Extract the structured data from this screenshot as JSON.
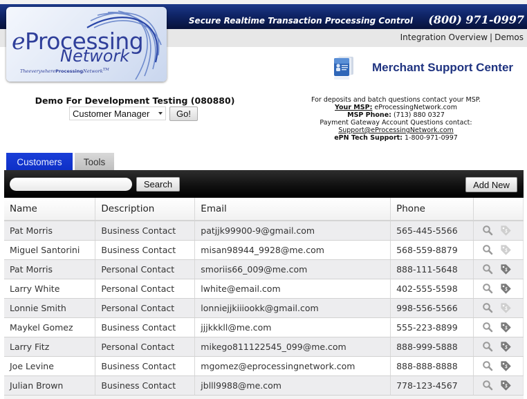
{
  "header": {
    "tagline": "Secure Realtime Transaction Processing Control",
    "phone": "(800) 971-0997",
    "links": [
      {
        "label": "Integration Overview"
      },
      {
        "label": "Demos"
      }
    ],
    "link_separator": "|"
  },
  "logo": {
    "line1_prefix": "e",
    "line1_rest": "Processing",
    "line2": "Network",
    "slogan_pre": "The",
    "slogan_everywhere": "everywhere",
    "slogan_processing": "Processing",
    "slogan_network": "Network",
    "slogan_tm": "TM"
  },
  "support_center": {
    "title": "Merchant Support Center",
    "icon": "id-card-icon"
  },
  "account": {
    "title": "Demo For Development Testing (080880)",
    "selected_module": "Customer Manager",
    "go_label": "Go!"
  },
  "contact": {
    "line1": "For deposits and batch questions contact your MSP.",
    "msp_label": "Your MSP:",
    "msp_value": "eProcessingNetwork.com",
    "msp_phone_label": "MSP Phone:",
    "msp_phone_value": "(713) 880 0327",
    "gateway_line": "Payment Gateway Account Questions contact:",
    "support_email": "Support@eProcessingNetwork.com",
    "tech_label": "ePN Tech Support:",
    "tech_value": "1-800-971-0997"
  },
  "tabs": [
    {
      "label": "Customers",
      "active": true
    },
    {
      "label": "Tools",
      "active": false
    }
  ],
  "toolbar": {
    "search_value": "",
    "search_label": "Search",
    "add_label": "Add New"
  },
  "table": {
    "columns": [
      "Name",
      "Description",
      "Email",
      "Phone",
      ""
    ],
    "rows": [
      {
        "name": "Pat Morris",
        "description": "Business Contact",
        "email": "patjjk99900-9@gmail.com",
        "phone": "565-445-5566",
        "tag_active": false
      },
      {
        "name": "Miguel Santorini",
        "description": "Business Contact",
        "email": "misan98944_9928@me.com",
        "phone": "568-559-8879",
        "tag_active": false
      },
      {
        "name": "Pat Morris",
        "description": "Personal Contact",
        "email": "smoriis66_009@me.com",
        "phone": "888-111-5648",
        "tag_active": true
      },
      {
        "name": "Larry White",
        "description": "Personal Contact",
        "email": "lwhite@email.com",
        "phone": "402-555-5598",
        "tag_active": true
      },
      {
        "name": "Lonnie Smith",
        "description": "Personal Contact",
        "email": "lonniejjkiiiookk@gmail.com",
        "phone": "998-556-5566",
        "tag_active": false
      },
      {
        "name": "Maykel Gomez",
        "description": "Business Contact",
        "email": "jjjkkkll@me.com",
        "phone": "555-223-8899",
        "tag_active": true
      },
      {
        "name": "Larry Fitz",
        "description": "Personal Contact",
        "email": "mikego811122545_099@me.com",
        "phone": "888-999-5888",
        "tag_active": true
      },
      {
        "name": "Joe Levine",
        "description": "Business Contact",
        "email": "mgomez@eprocessingnetwork.com",
        "phone": "888-888-8888",
        "tag_active": true
      },
      {
        "name": "Julian Brown",
        "description": "Business Contact",
        "email": "jblll9988@me.com",
        "phone": "778-123-4567",
        "tag_active": true
      }
    ]
  },
  "colors": {
    "banner": "#0f2466",
    "tab_active": "#1437d0",
    "title_blue": "#1f3380",
    "tag_active": "#7a7a7a",
    "tag_inactive": "#cfcfcf"
  }
}
